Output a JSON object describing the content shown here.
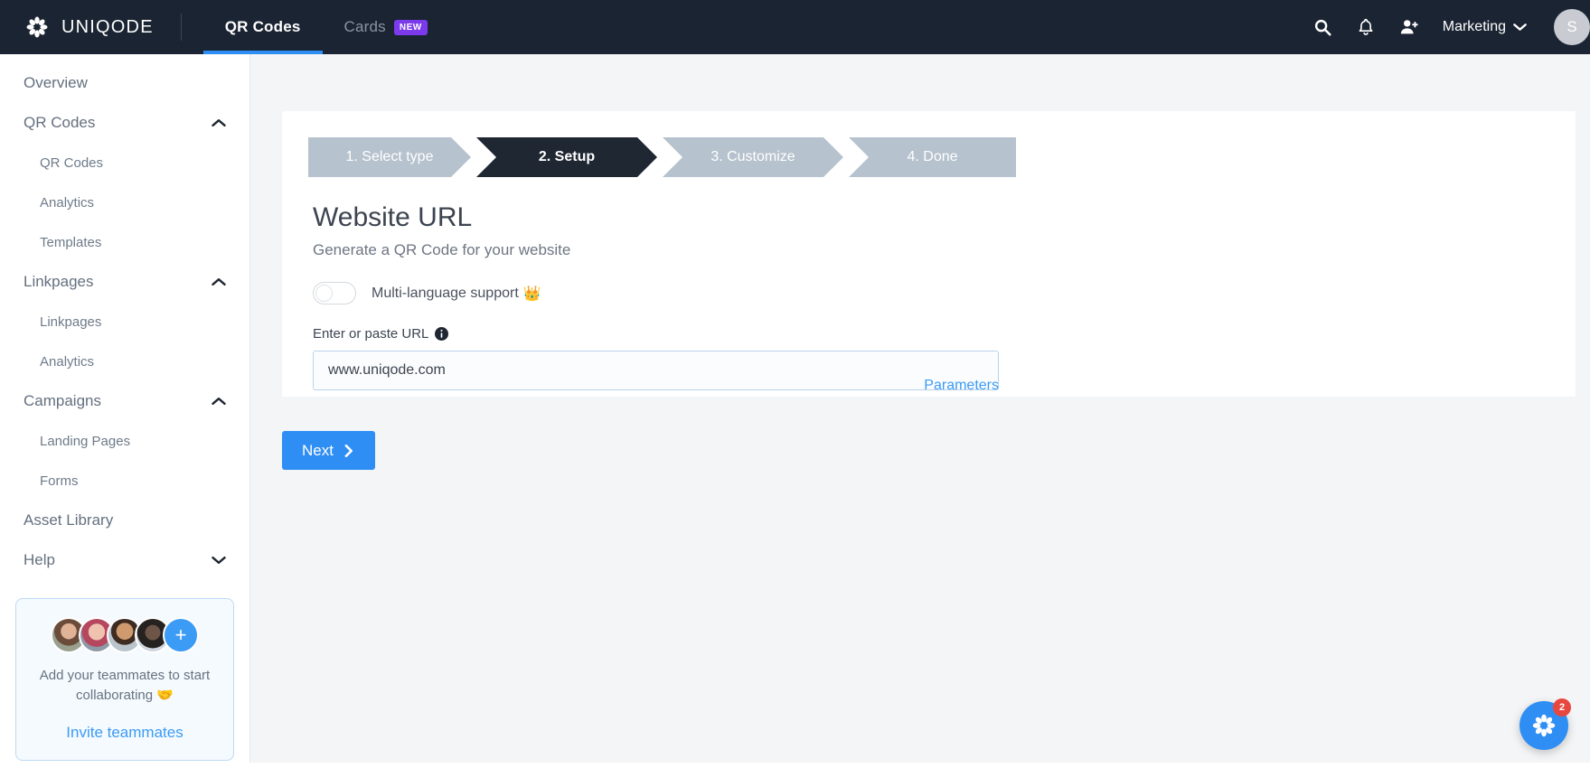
{
  "topnav": {
    "brand": "UNIQODE",
    "brand_icon": "flower-logo-icon",
    "tabs": [
      {
        "label": "QR Codes",
        "active": true,
        "badge": null
      },
      {
        "label": "Cards",
        "active": false,
        "badge": "NEW"
      }
    ],
    "icons": [
      "search-icon",
      "bell-icon",
      "add-user-icon"
    ],
    "account": "Marketing",
    "account_chevron": "chevron-down-icon",
    "avatar_initial": "S",
    "accent_color": "#2f8ef4",
    "background_color": "#1b2432",
    "badge_color": "#7c3aed"
  },
  "sidebar": {
    "items": [
      {
        "label": "Overview",
        "type": "top",
        "chevron": null
      },
      {
        "label": "QR Codes",
        "type": "top",
        "chevron": "chevron-up-icon"
      },
      {
        "label": "QR Codes",
        "type": "sub",
        "chevron": null
      },
      {
        "label": "Analytics",
        "type": "sub",
        "chevron": null
      },
      {
        "label": "Templates",
        "type": "sub",
        "chevron": null
      },
      {
        "label": "Linkpages",
        "type": "top",
        "chevron": "chevron-up-icon"
      },
      {
        "label": "Linkpages",
        "type": "sub",
        "chevron": null
      },
      {
        "label": "Analytics",
        "type": "sub",
        "chevron": null
      },
      {
        "label": "Campaigns",
        "type": "top",
        "chevron": "chevron-up-icon"
      },
      {
        "label": "Landing Pages",
        "type": "sub",
        "chevron": null
      },
      {
        "label": "Forms",
        "type": "sub",
        "chevron": null
      },
      {
        "label": "Asset Library",
        "type": "top",
        "chevron": null
      },
      {
        "label": "Help",
        "type": "top",
        "chevron": "chevron-down-icon"
      }
    ],
    "teammates_card": {
      "avatar_count": 4,
      "add_symbol": "+",
      "message": "Add your teammates to start collaborating 🤝",
      "link": "Invite teammates",
      "link_color": "#3b9bf5",
      "border_color": "#bcd9f5"
    }
  },
  "main": {
    "stepper": [
      {
        "label": "1. Select type",
        "active": false
      },
      {
        "label": "2. Setup",
        "active": true
      },
      {
        "label": "3. Customize",
        "active": false
      },
      {
        "label": "4. Done",
        "active": false
      }
    ],
    "stepper_inactive_color": "#b6c2cd",
    "stepper_active_color": "#1f2733",
    "title": "Website URL",
    "subtitle": "Generate a QR Code for your website",
    "multilanguage": {
      "label": "Multi-language support",
      "premium_icon": "crown-icon",
      "enabled": false
    },
    "url_field": {
      "label": "Enter or paste URL",
      "info_icon": "info-icon",
      "value": "www.uniqode.com",
      "placeholder": "www.uniqode.com"
    },
    "parameters_link": "Parameters",
    "next_button": {
      "label": "Next",
      "icon": "chevron-right-icon",
      "color": "#2f8ef4"
    }
  },
  "help_fab": {
    "icon": "flower-logo-icon",
    "badge_count": "2",
    "color": "#2f8ef4",
    "badge_color": "#e8473f"
  }
}
